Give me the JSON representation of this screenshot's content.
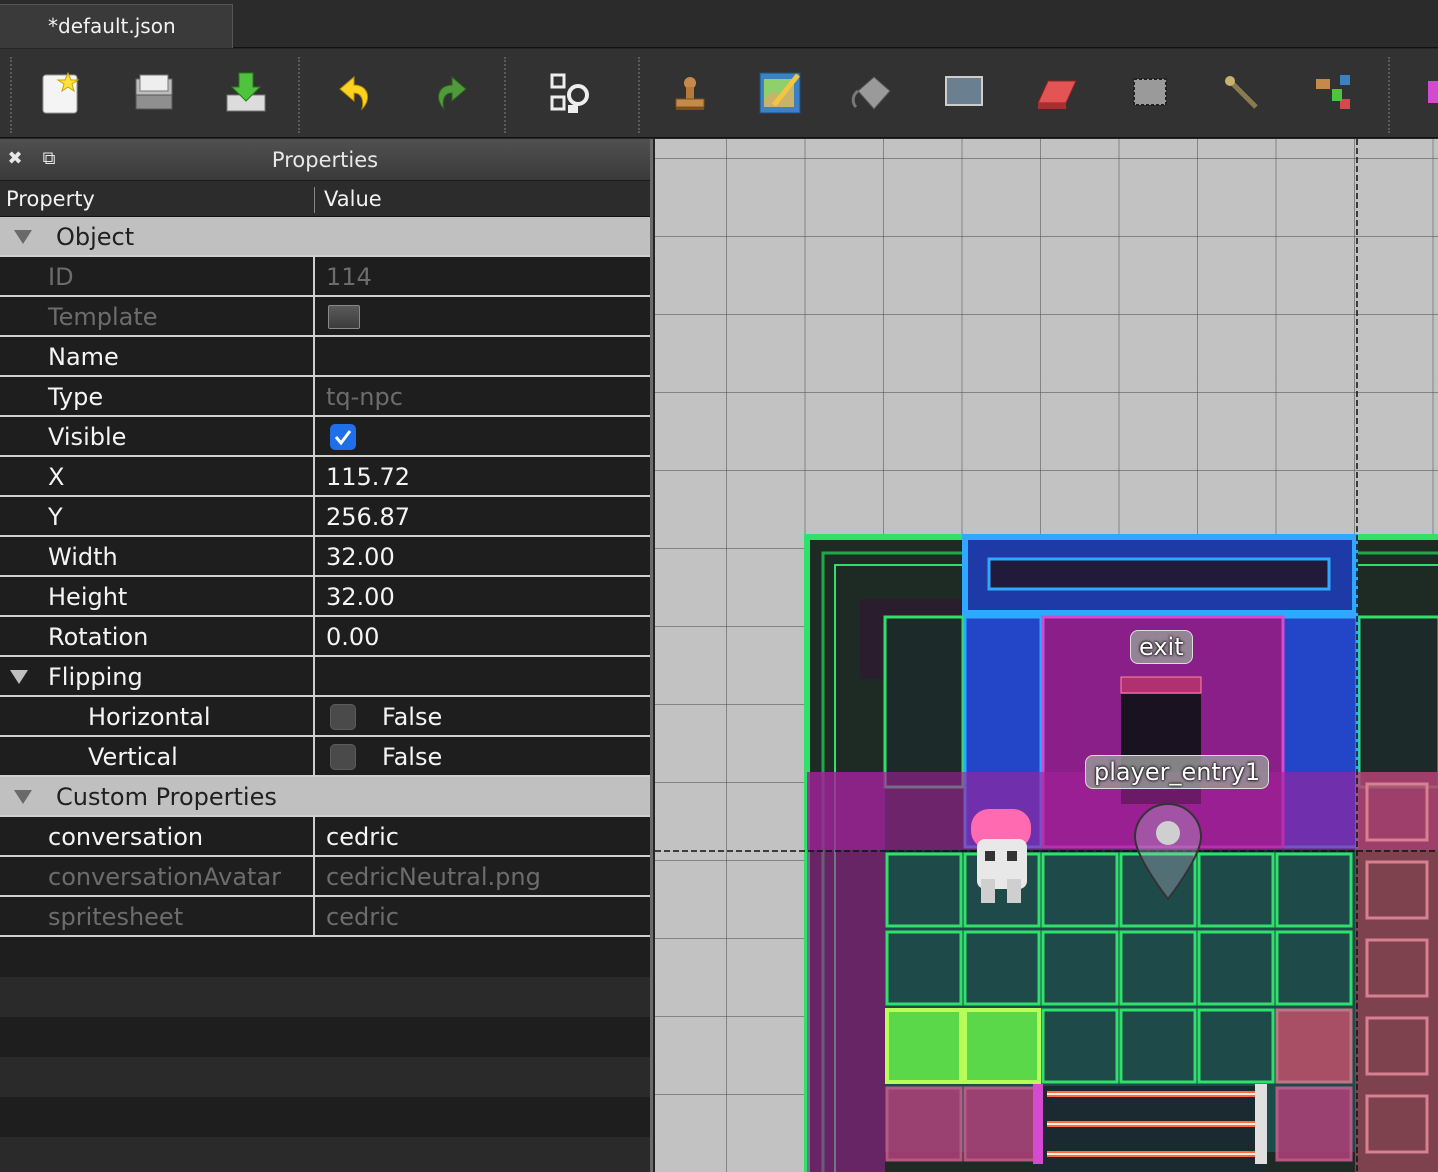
{
  "tab": {
    "title": "*default.json"
  },
  "toolbar": {
    "icons": [
      "new-map-icon",
      "open-file-icon",
      "save-icon",
      "undo-icon",
      "redo-icon",
      "commands-icon",
      "stamp-brush-icon",
      "terrain-brush-icon",
      "bucket-fill-icon",
      "shape-fill-icon",
      "eraser-icon",
      "rectangular-select-icon",
      "magic-wand-icon",
      "select-same-tile-icon"
    ]
  },
  "panel": {
    "title": "Properties",
    "columns": {
      "property": "Property",
      "value": "Value"
    },
    "groups": {
      "object": "Object",
      "flipping": "Flipping",
      "custom": "Custom Properties"
    },
    "object": {
      "id": {
        "key": "ID",
        "value": "114"
      },
      "template": {
        "key": "Template"
      },
      "name": {
        "key": "Name",
        "value": ""
      },
      "type": {
        "key": "Type",
        "value": "tq-npc"
      },
      "visible": {
        "key": "Visible",
        "checked": true
      },
      "x": {
        "key": "X",
        "value": "115.72"
      },
      "y": {
        "key": "Y",
        "value": "256.87"
      },
      "width": {
        "key": "Width",
        "value": "32.00"
      },
      "height": {
        "key": "Height",
        "value": "32.00"
      },
      "rotation": {
        "key": "Rotation",
        "value": "0.00"
      }
    },
    "flipping": {
      "horizontal": {
        "key": "Horizontal",
        "value": "False"
      },
      "vertical": {
        "key": "Vertical",
        "value": "False"
      }
    },
    "custom": {
      "conversation": {
        "key": "conversation",
        "value": "cedric"
      },
      "conversationAvatar": {
        "key": "conversationAvatar",
        "value": "cedricNeutral.png"
      },
      "spritesheet": {
        "key": "spritesheet",
        "value": "cedric"
      }
    }
  },
  "map": {
    "objects": [
      {
        "label": "exit"
      },
      {
        "label": "player_entry1"
      }
    ]
  },
  "colors": {
    "accent": "#1e6fe8",
    "neon_green": "#2fe06a",
    "neon_blue": "#2fa8ff",
    "magenta": "#a4209a"
  }
}
